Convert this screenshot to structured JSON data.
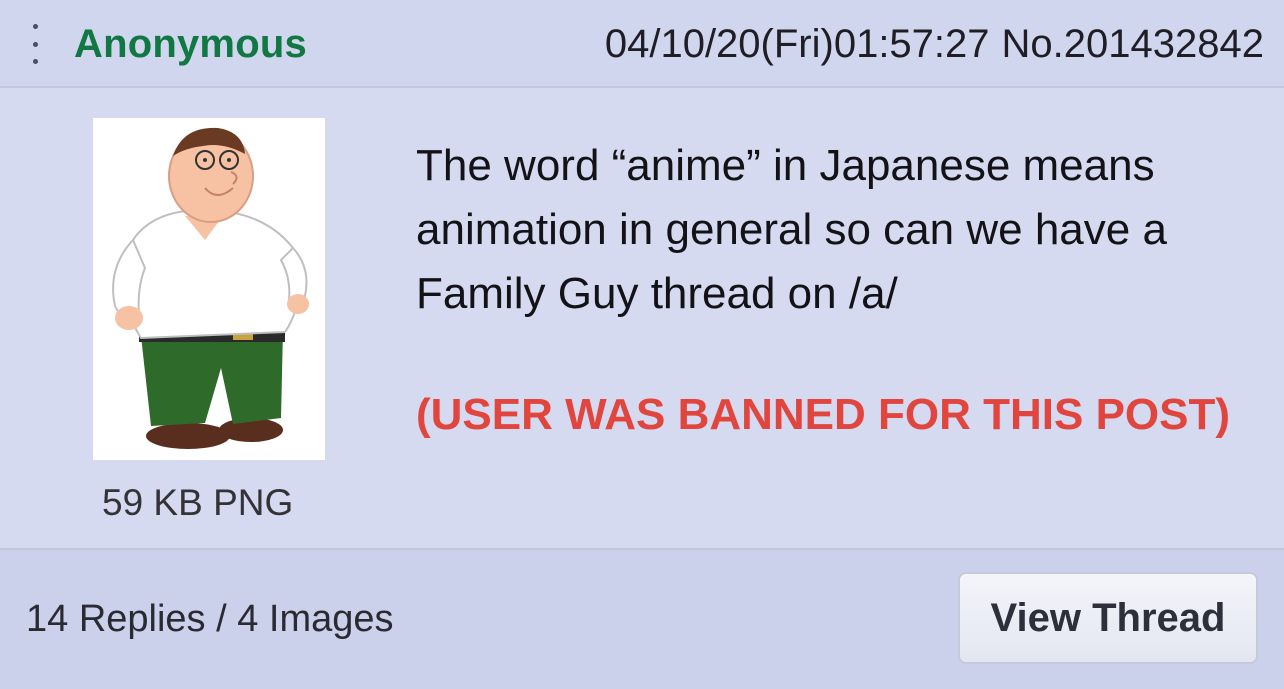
{
  "header": {
    "name": "Anonymous",
    "datetime": "04/10/20(Fri)01:57:27",
    "post_number": "No.201432842"
  },
  "post": {
    "file_info": "59 KB PNG",
    "message": "The word “anime” in Japanese means animation in general so can we have a Family Guy thread on /a/",
    "ban_notice": "(USER WAS BANNED FOR THIS POST)"
  },
  "footer": {
    "replies_summary": "14 Replies / 4 Images",
    "view_thread_label": "View Thread"
  },
  "colors": {
    "name": "#117743",
    "ban": "#e0453e",
    "background": "#d6daf0"
  }
}
